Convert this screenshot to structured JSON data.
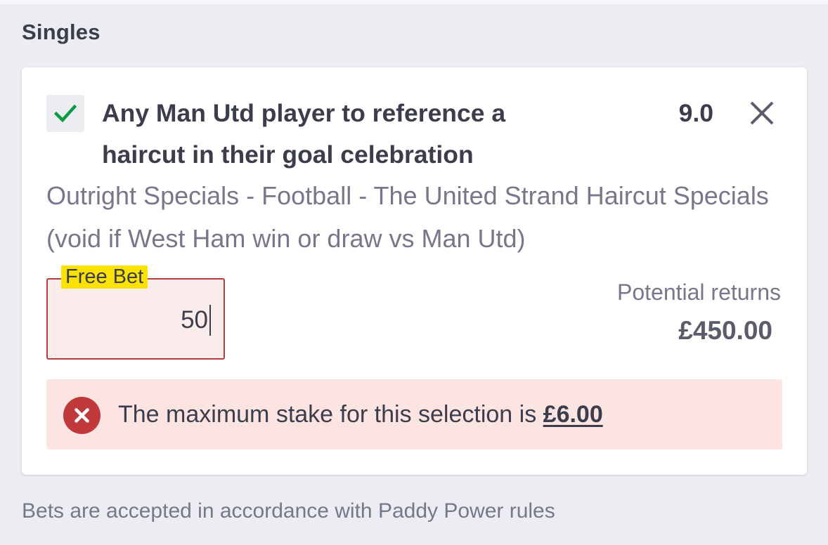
{
  "section": {
    "title": "Singles"
  },
  "selection": {
    "checked": true,
    "check_icon": "checkmark-icon",
    "title": "Any Man Utd player to reference a haircut in their goal celebration",
    "odds": "9.0",
    "remove_icon": "close-icon",
    "market": "Outright Specials - Football - The United Strand Haircut Specials (void if West Ham win or draw vs Man Utd)"
  },
  "stake": {
    "tag": "Free Bet",
    "value": "50"
  },
  "returns": {
    "label": "Potential returns",
    "value": "£450.00"
  },
  "error": {
    "icon": "error-x-icon",
    "message": "The maximum stake for this selection is ",
    "amount": "£6.00"
  },
  "footer": {
    "note": "Bets are accepted in accordance with Paddy Power rules"
  },
  "colors": {
    "background": "#ecedf3",
    "card": "#ffffff",
    "check_green": "#0b9a44",
    "error_red": "#c0393b",
    "error_bg": "#fce4e2",
    "stake_border": "#b23c40",
    "free_bet_yellow": "#fbe200",
    "text_primary": "#3c3d4c",
    "text_secondary": "#76778a"
  }
}
